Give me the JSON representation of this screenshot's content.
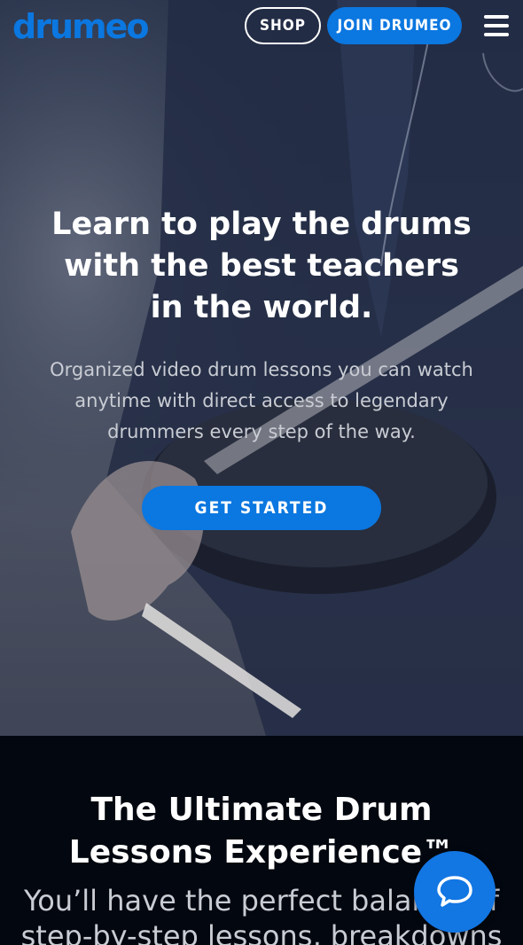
{
  "header": {
    "logo_text": "drumeo",
    "shop_label": "SHOP",
    "join_label": "JOIN DRUMEO",
    "menu_icon": "hamburger-menu-icon"
  },
  "hero": {
    "title_line1": "Learn to play the drums",
    "title_line2": "with the best teachers",
    "title_line3": "in the world.",
    "subtitle_line1": "Organized video drum lessons you can watch",
    "subtitle_line2": "anytime with direct access to legendary",
    "subtitle_line3": "drummers every step of the way.",
    "cta_label": "GET STARTED"
  },
  "section2": {
    "title_line1": "The Ultimate Drum",
    "title_line2": "Lessons Experience™",
    "body_line1": "You’ll have the perfect balance of",
    "body_line2": "step-by-step lessons, breakdowns"
  },
  "chat": {
    "icon": "chat-bubble-icon"
  },
  "colors": {
    "brand_blue": "#0b77e0",
    "dark_bg": "#03070f"
  }
}
